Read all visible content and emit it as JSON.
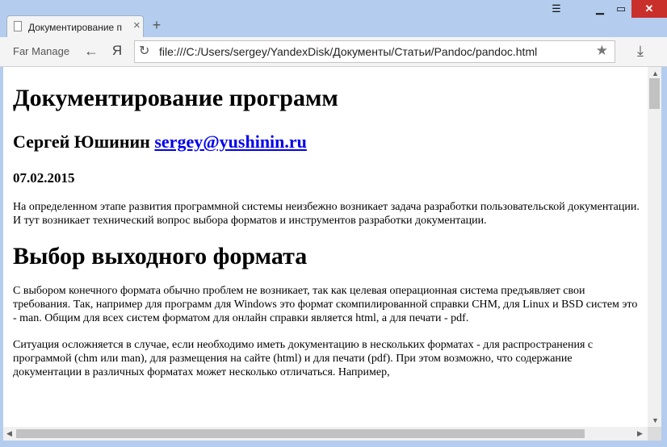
{
  "window": {
    "tab_title": "Документирование п",
    "close_glyph": "×",
    "new_tab_glyph": "+",
    "menu_glyph": "☰",
    "minimize_glyph": "▁",
    "maximize_glyph": "▭",
    "window_close_glyph": "✕"
  },
  "toolbar": {
    "bookmark_label": "Far Manage",
    "back_glyph": "←",
    "yandex_glyph": "Я",
    "reload_glyph": "↻",
    "url": "file:///C:/Users/sergey/YandexDisk/Документы/Статьи/Pandoc/pandoc.html",
    "star_glyph": "★",
    "download_glyph": "⤓"
  },
  "document": {
    "title": "Документирование программ",
    "author_name": "Сергей Юшинин",
    "author_email": "sergey@yushinin.ru",
    "date": "07.02.2015",
    "intro": "На определенном этапе развития программной системы неизбежно возникает задача разработки пользовательской документации. И тут возникает технический вопрос выбора форматов и инструментов разработки документации.",
    "section_title": "Выбор выходного формата",
    "para1": "С выбором конечного формата обычно проблем не возникает, так как целевая операционная система предъявляет свои требования. Так, например для программ для Windows это формат скомпилированной справки CHM, для Linux и BSD систем это - man. Общим для всех систем форматом для онлайн справки является html, а для печати - pdf.",
    "para2": "Ситуация осложняется в случае, если необходимо иметь документацию в нескольких форматах - для распространения с программой (chm или man), для размещения на сайте (html) и для печати (pdf). При этом возможно, что содержание документации в различных форматах может несколько отличаться. Например,"
  },
  "scroll": {
    "up": "▲",
    "down": "▼",
    "left": "◀",
    "right": "▶"
  },
  "colors": {
    "chrome": "#b4cdee",
    "close_red": "#c9302c",
    "link": "#0000ee"
  },
  "icons": [
    "page-icon",
    "menu-icon",
    "back-arrow-icon",
    "yandex-icon",
    "reload-icon",
    "star-icon",
    "download-icon"
  ]
}
